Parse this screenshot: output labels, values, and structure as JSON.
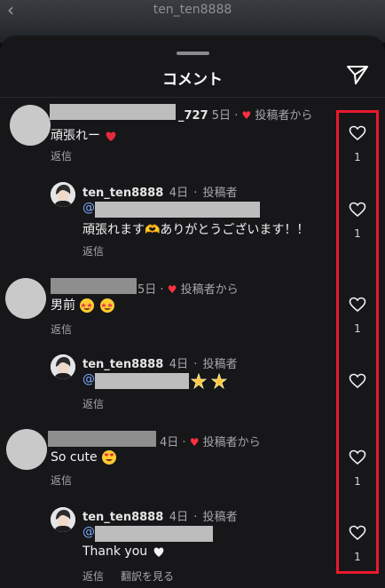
{
  "header": {
    "username": "ten_ten8888",
    "back_icon": "chevron-left-icon"
  },
  "sheet": {
    "title": "コメント",
    "share_icon": "send-icon"
  },
  "comments": [
    {
      "username_suffix": "_727",
      "date": "5日",
      "liked_by_author": "投稿者から",
      "text": "頑張れー",
      "emoji": "heart-exclamation",
      "reply": "返信",
      "likes": "1"
    },
    {
      "username": "ten_ten8888",
      "date": "4日",
      "author_badge": "投稿者",
      "mention": "@",
      "text": "頑張れます🫶ありがとうございます！！",
      "reply": "返信",
      "likes": "1"
    },
    {
      "date": "5日",
      "liked_by_author": "投稿者から",
      "text": "男前",
      "emoji": "star-struck x2",
      "reply": "返信",
      "likes": "1"
    },
    {
      "username": "ten_ten8888",
      "date": "4日",
      "author_badge": "投稿者",
      "mention": "@",
      "emoji": "glowing-star x2",
      "reply": "返信"
    },
    {
      "date": "4日",
      "liked_by_author": "投稿者から",
      "text": "So cute",
      "emoji": "heart-eyes",
      "reply": "返信",
      "likes": "1"
    },
    {
      "username": "ten_ten8888",
      "date": "4日",
      "author_badge": "投稿者",
      "mention": "@",
      "text": "Thank you",
      "emoji": "white-heart",
      "reply": "返信",
      "translate": "翻訳を見る",
      "likes": "1"
    }
  ],
  "colors": {
    "accent_red": "#e8192c",
    "heart_red": "#ff3040",
    "mention_blue": "#7fa9ff",
    "background": "#17171a"
  }
}
